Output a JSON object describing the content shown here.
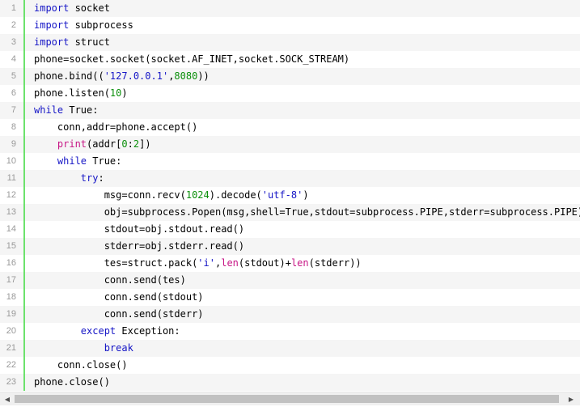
{
  "code": {
    "lines": [
      {
        "number": "1",
        "segments": [
          {
            "text": "import",
            "type": "kw"
          },
          {
            "text": " socket",
            "type": "plain"
          }
        ]
      },
      {
        "number": "2",
        "segments": [
          {
            "text": "import",
            "type": "kw"
          },
          {
            "text": " subprocess",
            "type": "plain"
          }
        ]
      },
      {
        "number": "3",
        "segments": [
          {
            "text": "import",
            "type": "kw"
          },
          {
            "text": " struct",
            "type": "plain"
          }
        ]
      },
      {
        "number": "4",
        "segments": [
          {
            "text": "phone=socket.socket(socket.AF_INET,socket.SOCK_STREAM)",
            "type": "plain"
          }
        ]
      },
      {
        "number": "5",
        "segments": [
          {
            "text": "phone.bind((",
            "type": "plain"
          },
          {
            "text": "'127.0.0.1'",
            "type": "str"
          },
          {
            "text": ",",
            "type": "plain"
          },
          {
            "text": "8080",
            "type": "num"
          },
          {
            "text": "))",
            "type": "plain"
          }
        ]
      },
      {
        "number": "6",
        "segments": [
          {
            "text": "phone.listen(",
            "type": "plain"
          },
          {
            "text": "10",
            "type": "num"
          },
          {
            "text": ")",
            "type": "plain"
          }
        ]
      },
      {
        "number": "7",
        "segments": [
          {
            "text": "while",
            "type": "kw"
          },
          {
            "text": " True:",
            "type": "plain"
          }
        ]
      },
      {
        "number": "8",
        "segments": [
          {
            "text": "    conn,addr=phone.accept()",
            "type": "plain"
          }
        ]
      },
      {
        "number": "9",
        "segments": [
          {
            "text": "    ",
            "type": "plain"
          },
          {
            "text": "print",
            "type": "builtin"
          },
          {
            "text": "(addr[",
            "type": "plain"
          },
          {
            "text": "0",
            "type": "num"
          },
          {
            "text": ":",
            "type": "plain"
          },
          {
            "text": "2",
            "type": "num"
          },
          {
            "text": "])",
            "type": "plain"
          }
        ]
      },
      {
        "number": "10",
        "segments": [
          {
            "text": "    ",
            "type": "plain"
          },
          {
            "text": "while",
            "type": "kw"
          },
          {
            "text": " True:",
            "type": "plain"
          }
        ]
      },
      {
        "number": "11",
        "segments": [
          {
            "text": "        ",
            "type": "plain"
          },
          {
            "text": "try",
            "type": "kw"
          },
          {
            "text": ":",
            "type": "plain"
          }
        ]
      },
      {
        "number": "12",
        "segments": [
          {
            "text": "            msg=conn.recv(",
            "type": "plain"
          },
          {
            "text": "1024",
            "type": "num"
          },
          {
            "text": ").decode(",
            "type": "plain"
          },
          {
            "text": "'utf-8'",
            "type": "str"
          },
          {
            "text": ")",
            "type": "plain"
          }
        ]
      },
      {
        "number": "13",
        "segments": [
          {
            "text": "            obj=subprocess.Popen(msg,shell=True,stdout=subprocess.PIPE,stderr=subprocess.PIPE)",
            "type": "plain"
          }
        ]
      },
      {
        "number": "14",
        "segments": [
          {
            "text": "            stdout=obj.stdout.read()",
            "type": "plain"
          }
        ]
      },
      {
        "number": "15",
        "segments": [
          {
            "text": "            stderr=obj.stderr.read()",
            "type": "plain"
          }
        ]
      },
      {
        "number": "16",
        "segments": [
          {
            "text": "            tes=struct.pack(",
            "type": "plain"
          },
          {
            "text": "'i'",
            "type": "str"
          },
          {
            "text": ",",
            "type": "plain"
          },
          {
            "text": "len",
            "type": "builtin"
          },
          {
            "text": "(stdout)+",
            "type": "plain"
          },
          {
            "text": "len",
            "type": "builtin"
          },
          {
            "text": "(stderr))",
            "type": "plain"
          }
        ]
      },
      {
        "number": "17",
        "segments": [
          {
            "text": "            conn.send(tes)",
            "type": "plain"
          }
        ]
      },
      {
        "number": "18",
        "segments": [
          {
            "text": "            conn.send(stdout)",
            "type": "plain"
          }
        ]
      },
      {
        "number": "19",
        "segments": [
          {
            "text": "            conn.send(stderr)",
            "type": "plain"
          }
        ]
      },
      {
        "number": "20",
        "segments": [
          {
            "text": "        ",
            "type": "plain"
          },
          {
            "text": "except",
            "type": "kw"
          },
          {
            "text": " Exception:",
            "type": "plain"
          }
        ]
      },
      {
        "number": "21",
        "segments": [
          {
            "text": "            ",
            "type": "plain"
          },
          {
            "text": "break",
            "type": "kw"
          }
        ]
      },
      {
        "number": "22",
        "segments": [
          {
            "text": "    conn.close()",
            "type": "plain"
          }
        ]
      },
      {
        "number": "23",
        "segments": [
          {
            "text": "phone.close()",
            "type": "plain"
          }
        ]
      }
    ]
  },
  "scrollbar": {
    "left_icon": "scroll-left-arrow-icon",
    "right_icon": "scroll-right-arrow-icon",
    "left_glyph": "◀",
    "right_glyph": "▶"
  },
  "colors": {
    "keyword": "#1515c6",
    "builtin": "#c71585",
    "string": "#1515c6",
    "number": "#0a8f0a",
    "gutter_border": "#6ce26c",
    "alt_row": "#f5f5f5"
  }
}
